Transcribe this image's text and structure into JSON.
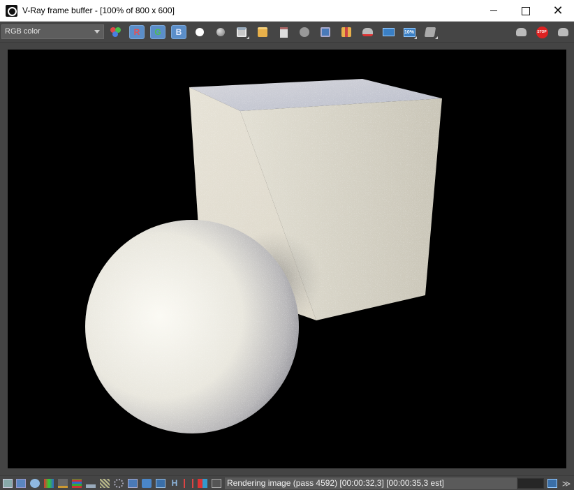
{
  "window": {
    "title": "V-Ray frame buffer - [100% of 800 x 600]",
    "minimize_icon": "minimize-icon",
    "maximize_icon": "maximize-icon",
    "close_glyph": "✕"
  },
  "toolbar": {
    "channel_select": {
      "value": "RGB color"
    },
    "channels": {
      "r_label": "R",
      "g_label": "G",
      "b_label": "B"
    },
    "lut_label": "10%",
    "stop_label": "STOP",
    "accent_color": "#5b8ec9"
  },
  "statusbar": {
    "h_label": "H",
    "status_text": "Rendering image (pass 4592) [00:00:32,3] [00:00:35,3 est]",
    "expand_glyph": "≫"
  }
}
